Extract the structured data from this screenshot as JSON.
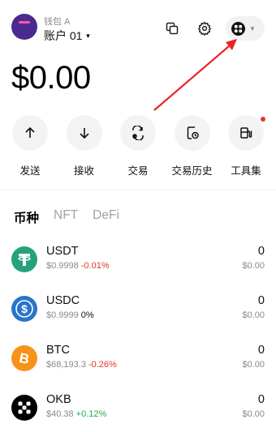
{
  "header": {
    "wallet_name": "钱包 A",
    "account_label": "账户 01",
    "icons": {
      "copy": "copy-icon",
      "settings": "gear-icon",
      "apps": "apps-grid-icon"
    }
  },
  "balance": "$0.00",
  "actions": [
    {
      "label": "发送",
      "icon": "arrow-up-icon"
    },
    {
      "label": "接收",
      "icon": "arrow-down-icon"
    },
    {
      "label": "交易",
      "icon": "swap-icon"
    },
    {
      "label": "交易历史",
      "icon": "history-icon"
    },
    {
      "label": "工具集",
      "icon": "fuel-icon",
      "has_badge": true
    }
  ],
  "tabs": [
    {
      "label": "币种",
      "active": true
    },
    {
      "label": "NFT",
      "active": false
    },
    {
      "label": "DeFi",
      "active": false
    }
  ],
  "tokens": [
    {
      "symbol": "USDT",
      "price": "$0.9998",
      "change": "-0.01%",
      "amount": "0",
      "value": "$0.00",
      "icon_color": "#26a17b",
      "icon": "usdt-icon"
    },
    {
      "symbol": "USDC",
      "price": "$0.9999",
      "change": "0%",
      "amount": "0",
      "value": "$0.00",
      "icon_color": "#2775ca",
      "icon": "usdc-icon"
    },
    {
      "symbol": "BTC",
      "price": "$68,193.3",
      "change": "-0.26%",
      "amount": "0",
      "value": "$0.00",
      "icon_color": "#f7931a",
      "icon": "btc-icon"
    },
    {
      "symbol": "OKB",
      "price": "$40.38",
      "change": "+0.12%",
      "amount": "0",
      "value": "$0.00",
      "icon_color": "#000000",
      "icon": "okb-icon"
    }
  ],
  "colors": {
    "negative": "#e5342d",
    "positive": "#22a84a",
    "annotation_arrow": "#e8232a"
  }
}
